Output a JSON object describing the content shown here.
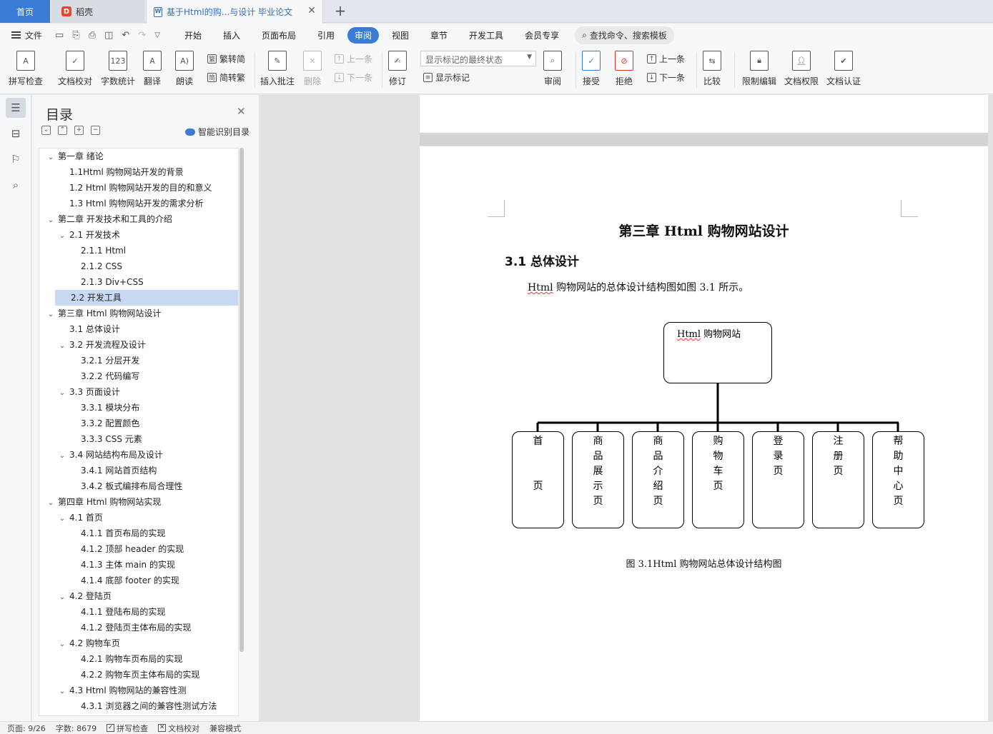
{
  "tabs": {
    "home": "首页",
    "daoke": "稻壳",
    "document": "基于Html的购...与设计 毕业论文"
  },
  "menu": {
    "file": "文件",
    "tabs": [
      "开始",
      "插入",
      "页面布局",
      "引用",
      "审阅",
      "视图",
      "章节",
      "开发工具",
      "会员专享"
    ],
    "active_tab": "审阅",
    "search_placeholder": "查找命令、搜索模板"
  },
  "ribbon": {
    "spell_check": "拼写检查",
    "doc_proof": "文档校对",
    "word_count": "字数统计",
    "translate": "翻译",
    "read_aloud": "朗读",
    "to_traditional": "繁转简",
    "to_simplified": "简转繁",
    "insert_comment": "插入批注",
    "delete": "删除",
    "prev": "上一条",
    "next": "下一条",
    "track_changes": "修订",
    "markup_mode": "显示标记的最终状态",
    "show_markup": "显示标记",
    "review": "审阅",
    "accept": "接受",
    "reject": "拒绝",
    "prev_change": "上一条",
    "next_change": "下一条",
    "compare": "比较",
    "restrict_edit": "限制编辑",
    "doc_permission": "文档权限",
    "doc_cert": "文档认证"
  },
  "outline": {
    "title": "目录",
    "smart": "智能识别目录",
    "items": [
      {
        "level": 1,
        "text": "第一章  绪论",
        "caret": true
      },
      {
        "level": 2,
        "text": "1.1Html 购物网站开发的背景"
      },
      {
        "level": 2,
        "text": "1.2 Html 购物网站开发的目的和意义"
      },
      {
        "level": 2,
        "text": "1.3 Html 购物网站开发的需求分析"
      },
      {
        "level": 1,
        "text": "第二章  开发技术和工具的介绍",
        "caret": true
      },
      {
        "level": 2,
        "text": "2.1 开发技术",
        "caret": true
      },
      {
        "level": 3,
        "text": "2.1.1 Html"
      },
      {
        "level": 3,
        "text": "2.1.2 CSS"
      },
      {
        "level": 3,
        "text": "2.1.3 Div+CSS"
      },
      {
        "level": 2,
        "text": "2.2 开发工具",
        "selected": true
      },
      {
        "level": 1,
        "text": "第三章  Html 购物网站设计",
        "caret": true
      },
      {
        "level": 2,
        "text": "3.1 总体设计"
      },
      {
        "level": 2,
        "text": "3.2 开发流程及设计",
        "caret": true
      },
      {
        "level": 3,
        "text": "3.2.1  分层开发"
      },
      {
        "level": 3,
        "text": "3.2.2  代码编写"
      },
      {
        "level": 2,
        "text": "3.3 页面设计",
        "caret": true
      },
      {
        "level": 3,
        "text": "3.3.1 模块分布"
      },
      {
        "level": 3,
        "text": "3.3.2  配置颜色"
      },
      {
        "level": 3,
        "text": "3.3.3 CSS 元素"
      },
      {
        "level": 2,
        "text": "3.4 网站结构布局及设计",
        "caret": true
      },
      {
        "level": 3,
        "text": "3.4.1  网站首页结构"
      },
      {
        "level": 3,
        "text": "3.4.2  板式编排布局合理性"
      },
      {
        "level": 1,
        "text": "第四章  Html 购物网站实现",
        "caret": true
      },
      {
        "level": 2,
        "text": "4.1 首页",
        "caret": true
      },
      {
        "level": 3,
        "text": "4.1.1 首页布局的实现"
      },
      {
        "level": 3,
        "text": "4.1.2  顶部 header 的实现"
      },
      {
        "level": 3,
        "text": "4.1.3  主体 main 的实现"
      },
      {
        "level": 3,
        "text": "4.1.4  底部 footer 的实现"
      },
      {
        "level": 2,
        "text": "4.2  登陆页",
        "caret": true
      },
      {
        "level": 3,
        "text": "4.1.1 登陆布局的实现"
      },
      {
        "level": 3,
        "text": "4.1.2 登陆页主体布局的实现"
      },
      {
        "level": 2,
        "text": "4.2  购物车页",
        "caret": true
      },
      {
        "level": 3,
        "text": "4.2.1 购物车页布局的实现"
      },
      {
        "level": 3,
        "text": "4.2.2 购物车页主体布局的实现"
      },
      {
        "level": 2,
        "text": "4.3 Html 购物网站的兼容性测",
        "caret": true
      },
      {
        "level": 3,
        "text": "4.3.1 浏览器之间的兼容性测试方法"
      }
    ]
  },
  "document": {
    "chapter_title": "第三章 Html 购物网站设计",
    "section_title": "3.1 总体设计",
    "para_prefix": "Html",
    "para_rest": " 购物网站的总体设计结构图如图 3.1 所示。",
    "chart_root_prefix": "Html",
    "chart_root_rest": " 购物网站",
    "chart_children": [
      [
        "首",
        "",
        "",
        "页"
      ],
      [
        "商",
        "品",
        "展",
        "示",
        "页"
      ],
      [
        "商",
        "品",
        "介",
        "绍",
        "页"
      ],
      [
        "购",
        "物",
        "车",
        "页"
      ],
      [
        "登",
        "录",
        "页"
      ],
      [
        "注",
        "册",
        "页"
      ],
      [
        "帮",
        "助",
        "中",
        "心",
        "页"
      ]
    ],
    "caption": "图 3.1Html 购物网站总体设计结构图"
  },
  "status": {
    "page": "页面: 9/26",
    "words": "字数: 8679",
    "spell": "拼写检查",
    "proof": "文档校对",
    "compat": "兼容模式"
  }
}
